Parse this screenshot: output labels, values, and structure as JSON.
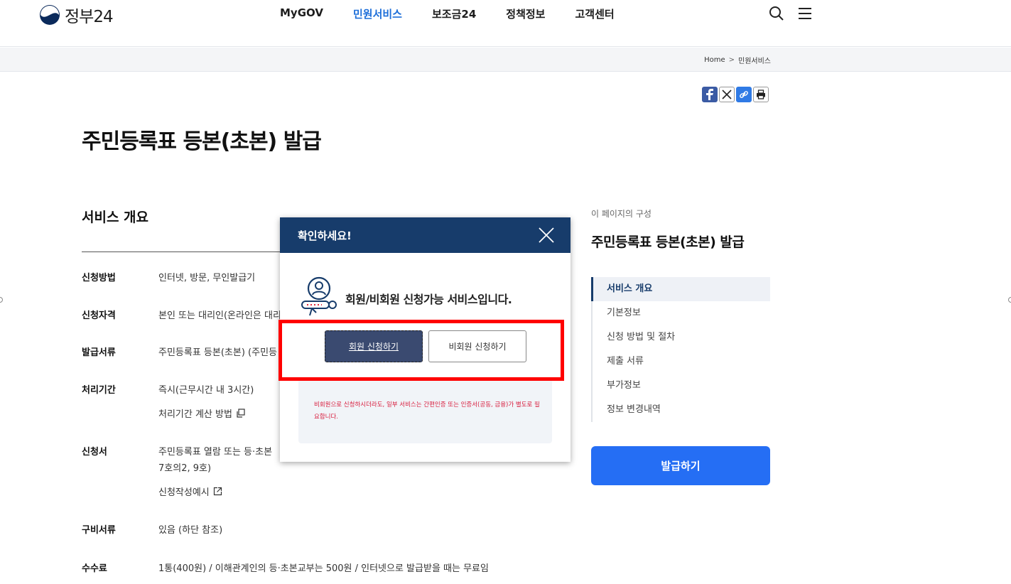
{
  "header": {
    "logo_text": "정부24",
    "nav": [
      "MyGOV",
      "민원서비스",
      "보조금24",
      "정책정보",
      "고객센터"
    ],
    "active_nav_index": 1
  },
  "breadcrumb": {
    "home": "Home",
    "sep": ">",
    "current": "민원서비스"
  },
  "page_title": "주민등록표 등본(초본) 발급",
  "overview": {
    "title": "서비스 개요",
    "rows": [
      {
        "label": "신청방법",
        "value": "인터넷, 방문, 무인발급기"
      },
      {
        "label": "신청자격",
        "value": "본인 또는 대리인(온라인은 대리"
      },
      {
        "label": "발급서류",
        "value": "주민등록표 등본(초본) (주민등"
      },
      {
        "label": "처리기간",
        "value": "즉시(근무시간 내 3시간)"
      },
      {
        "label": "신청서",
        "value": "주민등록표 열람 또는 등·초본"
      },
      {
        "label": "구비서류",
        "value": "있음 (하단 참조)"
      },
      {
        "label": "수수료",
        "value": "1통(400원) / 이해관계인의 등·초본교부는 500원 / 인터넷으로 발급받을 때는 무료임"
      }
    ],
    "processing_calc_link": "처리기간 계산 방법",
    "form_value_line2": "7호의2, 9호)",
    "form_example_link": "신청작성예시"
  },
  "toc": {
    "caption": "이 페이지의 구성",
    "title": "주민등록표 등본(초본) 발급",
    "items": [
      "서비스 개요",
      "기본정보",
      "신청 방법 및 절차",
      "제출 서류",
      "부가정보",
      "정보 변경내역"
    ],
    "active_index": 0,
    "apply_button": "발급하기"
  },
  "modal": {
    "title": "확인하세요!",
    "message": "회원/비회원 신청가능 서비스입니다.",
    "member_button": "회원 신청하기",
    "nonmember_button": "비회원 신청하기",
    "notice": "비회원으로 신청하시더라도, 일부 서비스는 간편인증 또는 인증서(공동, 금융)가 별도로 필요합니다."
  },
  "colors": {
    "brand_navy": "#173c6b",
    "primary_blue": "#256ef4",
    "active_nav": "#1e6fd9",
    "highlight": "#ff0000",
    "notice_red": "#d81b3c"
  },
  "icons": [
    "government-logo-icon",
    "search-icon",
    "menu-icon",
    "facebook-icon",
    "x-icon",
    "link-icon",
    "print-icon",
    "close-icon",
    "member-key-icon",
    "copy-icon",
    "external-link-icon"
  ]
}
